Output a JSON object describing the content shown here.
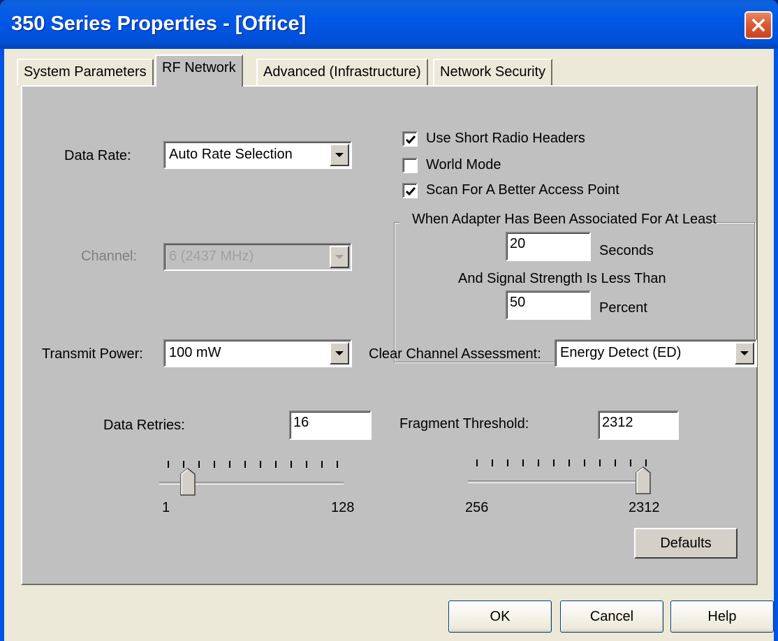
{
  "window": {
    "title": "350 Series Properties - [Office]"
  },
  "tabs": [
    {
      "label": "System Parameters"
    },
    {
      "label": "RF Network",
      "active": true
    },
    {
      "label": "Advanced (Infrastructure)"
    },
    {
      "label": "Network Security"
    }
  ],
  "rf": {
    "data_rate": {
      "label": "Data Rate:",
      "value": "Auto Rate Selection"
    },
    "channel": {
      "label": "Channel:",
      "value": "6   (2437 MHz)",
      "disabled": true
    },
    "transmit_power": {
      "label": "Transmit Power:",
      "value": "100 mW"
    },
    "options": {
      "short_headers": {
        "label": "Use Short Radio Headers",
        "checked": true
      },
      "world_mode": {
        "label": "World Mode",
        "checked": false
      },
      "scan_better_ap": {
        "label": "Scan For A Better Access Point",
        "checked": true
      }
    },
    "scan": {
      "associated_text": "When Adapter Has Been Associated For At Least",
      "seconds_value": "20",
      "seconds_unit": "Seconds",
      "signal_text": "And Signal Strength Is Less Than",
      "percent_value": "50",
      "percent_unit": "Percent"
    },
    "cca": {
      "label": "Clear Channel Assessment:",
      "value": "Energy Detect (ED)"
    },
    "data_retries": {
      "label": "Data Retries:",
      "value": "16",
      "min": "1",
      "max": "128"
    },
    "fragment_threshold": {
      "label": "Fragment Threshold:",
      "value": "2312",
      "min": "256",
      "max": "2312"
    },
    "defaults_label": "Defaults"
  },
  "footer": {
    "ok_label": "OK",
    "cancel_label": "Cancel",
    "help_label": "Help"
  }
}
